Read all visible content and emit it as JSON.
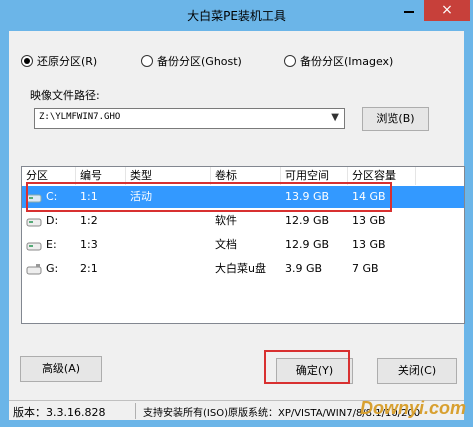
{
  "window": {
    "title": "大白菜PE装机工具",
    "minimize_label": "",
    "close_glyph": "×"
  },
  "mode": {
    "restore_label": "还原分区(R)",
    "backup_ghost_label": "备份分区(Ghost)",
    "backup_imagex_label": "备份分区(Imagex)",
    "selected": "restore"
  },
  "image_path": {
    "label": "映像文件路径:",
    "value": "Z:\\YLMFWIN7.GHO",
    "browse_label": "浏览(B)"
  },
  "partitions": {
    "columns": [
      "分区",
      "编号",
      "类型",
      "卷标",
      "可用空间",
      "分区容量"
    ],
    "rows": [
      {
        "drive": "C:",
        "num": "1:1",
        "type": "活动",
        "label": "",
        "free": "13.9 GB",
        "size": "14 GB"
      },
      {
        "drive": "D:",
        "num": "1:2",
        "type": "",
        "label": "软件",
        "free": "12.9 GB",
        "size": "13 GB"
      },
      {
        "drive": "E:",
        "num": "1:3",
        "type": "",
        "label": "文档",
        "free": "12.9 GB",
        "size": "13 GB"
      },
      {
        "drive": "G:",
        "num": "2:1",
        "type": "",
        "label": "大白菜u盘",
        "free": "3.9 GB",
        "size": "7 GB"
      }
    ],
    "selected_index": 0
  },
  "buttons": {
    "advanced_label": "高级(A)",
    "ok_label": "确定(Y)",
    "close_label": "关闭(C)"
  },
  "status": {
    "version": "版本：3.3.16.828",
    "info": "支持安装所有(ISO)原版系统：XP/VISTA/WIN7/8/8.1/10/200"
  },
  "watermark": "Downyi.com",
  "colors": {
    "accent_blue": "#6bb5e8",
    "selection": "#3399ff",
    "highlight_red": "#d83030",
    "close_red": "#c7403a"
  }
}
